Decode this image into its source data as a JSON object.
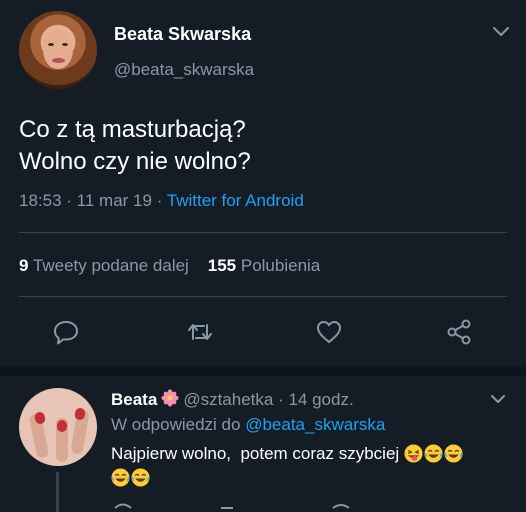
{
  "tweet": {
    "author_name": "Beata Skwarska",
    "author_handle": "@beata_skwarska",
    "text_line1": "Co z tą masturbacją?",
    "text_line2": "Wolno czy nie wolno?",
    "time": "18:53",
    "date": "11 mar 19",
    "source": "Twitter for Android",
    "retweets_count": "9",
    "retweets_label": "Tweety podane dalej",
    "likes_count": "155",
    "likes_label": "Polubienia",
    "icons": [
      "reply-icon",
      "retweet-icon",
      "like-icon",
      "share-icon"
    ]
  },
  "reply": {
    "author_name": "Beata",
    "author_handle": "@sztahetka",
    "age": "14 godz.",
    "replying_to_prefix": "W odpowiedzi do",
    "replying_to_handle": "@beata_skwarska",
    "text": "Najpierw wolno,  potem coraz szybciej"
  },
  "colors": {
    "background": "#141d26",
    "link": "#1da1f2",
    "secondary_text": "#8899a6",
    "divider": "#38444d"
  }
}
